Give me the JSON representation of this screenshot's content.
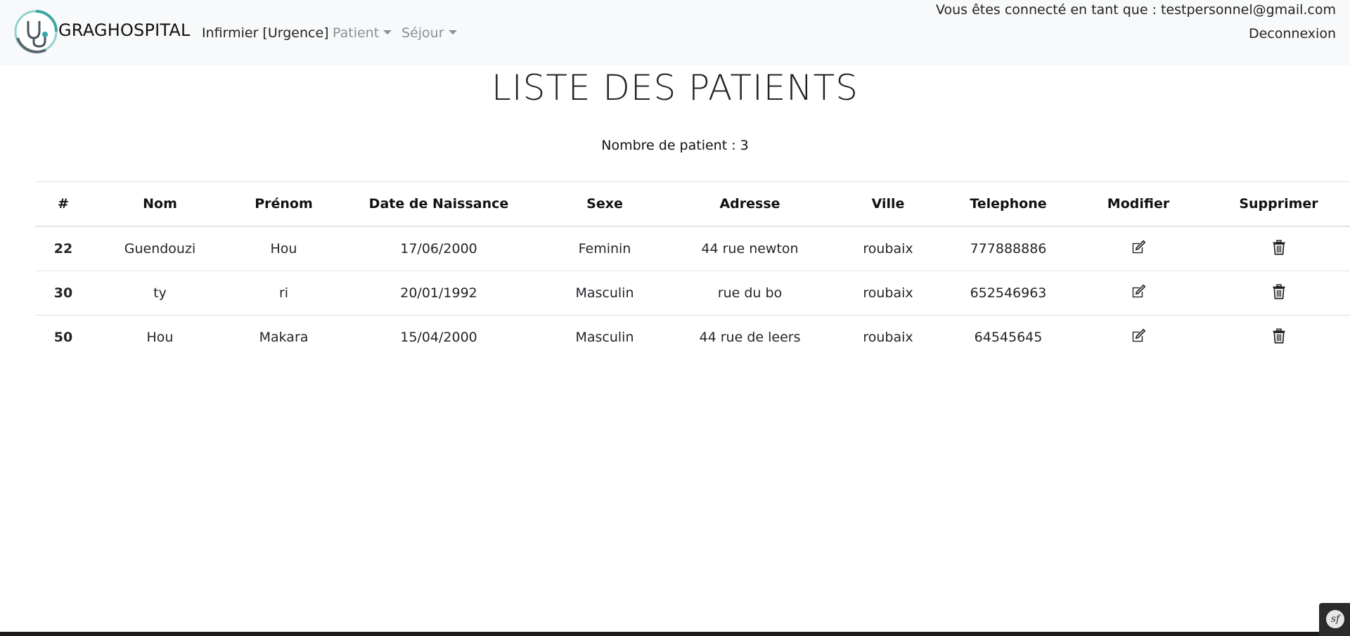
{
  "navbar": {
    "brand": "GRAGHOSPITAL",
    "role": "Infirmier [Urgence]",
    "menu_patient": "Patient",
    "menu_sejour": "Séjour",
    "user_line": "Vous êtes connecté en tant que : testpersonnel@gmail.com",
    "logout": "Deconnexion"
  },
  "main": {
    "title": "LISTE DES PATIENTS",
    "count": "Nombre de patient : 3"
  },
  "table": {
    "headers": [
      "#",
      "Nom",
      "Prénom",
      "Date de Naissance",
      "Sexe",
      "Adresse",
      "Ville",
      "Telephone",
      "Modifier",
      "Supprimer"
    ],
    "rows": [
      {
        "id": "22",
        "nom": "Guendouzi",
        "prenom": "Hou",
        "naissance": "17/06/2000",
        "sexe": "Feminin",
        "adresse": "44 rue newton",
        "ville": "roubaix",
        "telephone": "777888886"
      },
      {
        "id": "30",
        "nom": "ty",
        "prenom": "ri",
        "naissance": "20/01/1992",
        "sexe": "Masculin",
        "adresse": "rue du bo",
        "ville": "roubaix",
        "telephone": "652546963"
      },
      {
        "id": "50",
        "nom": "Hou",
        "prenom": "Makara",
        "naissance": "15/04/2000",
        "sexe": "Masculin",
        "adresse": "44 rue de leers",
        "ville": "roubaix",
        "telephone": "64545645"
      }
    ],
    "edit_icon": "edit-icon",
    "delete_icon": "trash-icon"
  },
  "debug_badge": {
    "icon": "symfony-icon",
    "label": "sf"
  },
  "colors": {
    "navbar_bg": "#f8f9fa",
    "logo_accent": "#3aa6a3",
    "muted": "#8a8f94"
  }
}
